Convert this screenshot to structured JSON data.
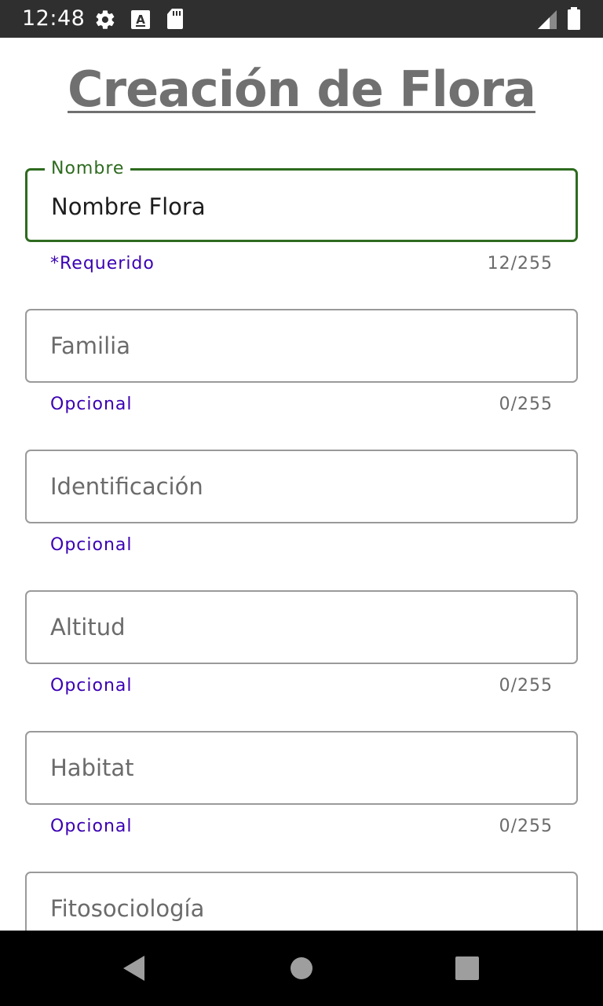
{
  "status_bar": {
    "time": "12:48",
    "icons": [
      "gear-icon",
      "font-a-icon",
      "sd-card-icon",
      "signal-icon",
      "battery-icon"
    ]
  },
  "page": {
    "title": "Creación de Flora"
  },
  "form": {
    "fields": [
      {
        "label": "Nombre",
        "value": "Nombre Flora",
        "placeholder": "",
        "helper": "*Requerido",
        "counter": "12/255",
        "focused": true
      },
      {
        "label": "",
        "value": "",
        "placeholder": "Familia",
        "helper": "Opcional",
        "counter": "0/255",
        "focused": false
      },
      {
        "label": "",
        "value": "",
        "placeholder": "Identificación",
        "helper": "Opcional",
        "counter": "",
        "focused": false
      },
      {
        "label": "",
        "value": "",
        "placeholder": "Altitud",
        "helper": "Opcional",
        "counter": "0/255",
        "focused": false
      },
      {
        "label": "",
        "value": "",
        "placeholder": "Habitat",
        "helper": "Opcional",
        "counter": "0/255",
        "focused": false
      },
      {
        "label": "",
        "value": "",
        "placeholder": "Fitosociología",
        "helper": "",
        "counter": "",
        "focused": false
      }
    ]
  },
  "colors": {
    "status_bar_bg": "#2f2f2f",
    "title": "#707070",
    "focus_border": "#2e6b1f",
    "helper_text": "#3b00b3",
    "counter_text": "#6b6b6b",
    "border": "#9a9a9a",
    "nav_bar_bg": "#000000",
    "nav_icon": "#9e9e9e"
  },
  "nav_bar": {
    "icons": [
      "back-icon",
      "home-icon",
      "recents-icon"
    ]
  }
}
